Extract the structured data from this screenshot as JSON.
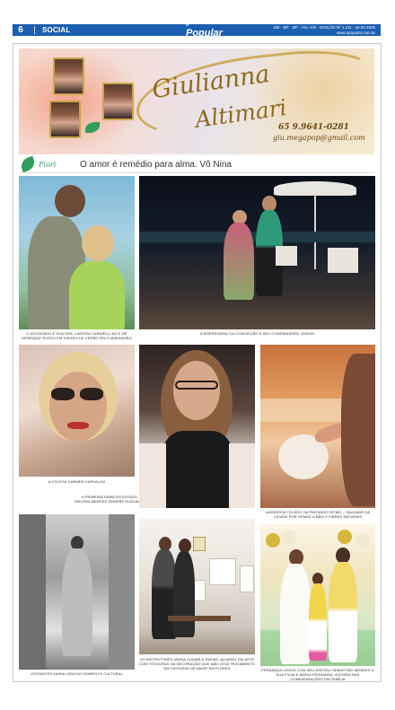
{
  "header": {
    "page_number": "6",
    "section": "SOCIAL",
    "brand": "Popular",
    "brand_prefix": "o",
    "edition_line1": "MS · MT · DF · Ano XXI · EDIÇÃO Nº 1.111 · 16.02.2025",
    "edition_line2": "www.opopular.com.br"
  },
  "banner": {
    "name_line1": "Giulianna",
    "name_line2": "Altimari",
    "phone": "65 9.9641-0281",
    "email": "giu.megapop@gmail.com"
  },
  "column": {
    "logo_text": "Fiori",
    "headline": "O amor é remédio para alma. Vô Nina"
  },
  "captions": {
    "p1": "O advogado e sua Dra. Larissa Carnielli ao e Dr Henrique Russo em viagem de verão pelo Maranhão",
    "p2": "A empresária Tia Conceição e seu companheiro Júnior",
    "p3": "A colega Carmen Carvalho",
    "p4": "A primeira dama do estado Virgínia Mendes sempre elegante",
    "p5": "Andressa Toledo da Pintando Ritmo – saudade da cidade por gemas a mão e fibras naturais",
    "p6": "Visitantes Maria Lídia no momento cultural",
    "p7": "Os instrutores Maria Cuiabá e Rafael Alvarez em arte com tesouras na decoração que não leva tratamento em pinturas de amor em flores",
    "p8": "Fernanda Lemos com seu esposo Sebastião Mendes e sua filha e Maria Fernanda. Alegria nas comemorações em família"
  },
  "colors": {
    "header_blue": "#1c5fb0",
    "gold": "#c9a44a",
    "leaf_green": "#2f9e5a"
  }
}
